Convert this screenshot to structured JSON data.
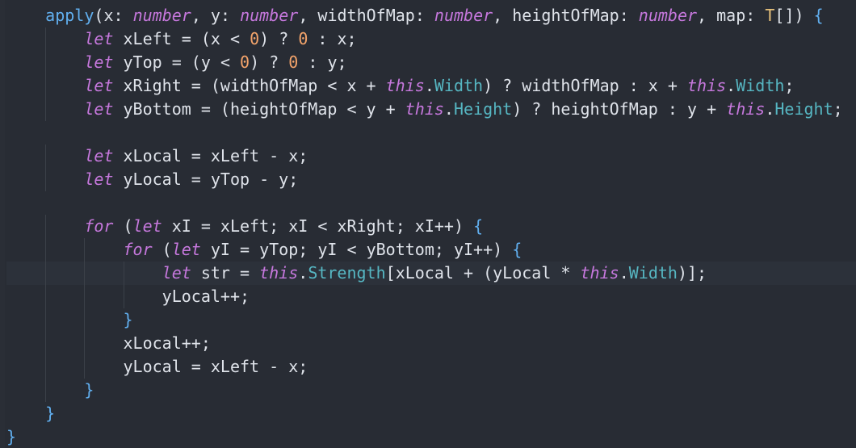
{
  "code_lines": [
    "    apply(x: number, y: number, widthOfMap: number, heightOfMap: number, map: T[]) {",
    "        let xLeft = (x < 0) ? 0 : x;",
    "        let yTop = (y < 0) ? 0 : y;",
    "        let xRight = (widthOfMap < x + this.Width) ? widthOfMap : x + this.Width;",
    "        let yBottom = (heightOfMap < y + this.Height) ? heightOfMap : y + this.Height;",
    "",
    "        let xLocal = xLeft - x;",
    "        let yLocal = yTop - y;",
    "",
    "        for (let xI = xLeft; xI < xRight; xI++) {",
    "            for (let yI = yTop; yI < yBottom; yI++) {",
    "                let str = this.Strength[xLocal + (yLocal * this.Width)];",
    "                yLocal++;",
    "            }",
    "            xLocal++;",
    "            yLocal = xLeft - x;",
    "        }",
    "    }",
    "}"
  ],
  "active_line_index": 11,
  "colors": {
    "background": "#282c34",
    "keyword": "#c678dd",
    "function": "#61afef",
    "number": "#f4a46b",
    "property": "#56b6c2",
    "text": "#dfe3ea"
  }
}
